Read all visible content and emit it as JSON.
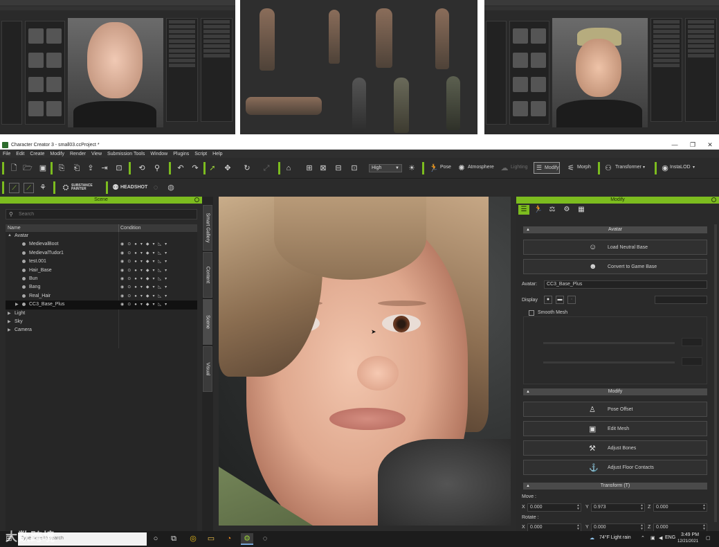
{
  "window": {
    "title": "Character Creator 3 - small03.ccProject *",
    "minimize": "—",
    "maximize": "❐",
    "close": "✕"
  },
  "menu": [
    "File",
    "Edit",
    "Create",
    "Modify",
    "Render",
    "View",
    "Submission Tools",
    "Window",
    "Plugins",
    "Script",
    "Help"
  ],
  "toolbar": {
    "quality": "High",
    "pose": "Pose",
    "atmosphere": "Atmosphere",
    "lighting": "Lighting",
    "modify": "Modify",
    "morph": "Morph",
    "transformer": "Transformer",
    "instalod": "InstaLOD",
    "substance": "SUBSTANCE PAINTER",
    "headshot": "HEADSHOT"
  },
  "scene": {
    "title": "Scene",
    "search_placeholder": "Search",
    "col_name": "Name",
    "col_condition": "Condition",
    "items": [
      {
        "label": "Avatar",
        "level": 0,
        "twist": "▲"
      },
      {
        "label": "MedievalBoot",
        "level": 2,
        "twist": ""
      },
      {
        "label": "MedievalTudor1",
        "level": 2,
        "twist": ""
      },
      {
        "label": "test.001",
        "level": 2,
        "twist": ""
      },
      {
        "label": "Hair_Base",
        "level": 2,
        "twist": ""
      },
      {
        "label": "Bun",
        "level": 2,
        "twist": ""
      },
      {
        "label": "Bang",
        "level": 2,
        "twist": ""
      },
      {
        "label": "Real_Hair",
        "level": 2,
        "twist": ""
      },
      {
        "label": "CC3_Base_Plus",
        "level": 1,
        "twist": "▶"
      },
      {
        "label": "Light",
        "level": 0,
        "twist": "▶"
      },
      {
        "label": "Sky",
        "level": 0,
        "twist": "▶"
      },
      {
        "label": "Camera",
        "level": 0,
        "twist": "▶"
      }
    ],
    "selected_item": "CC3_Base_Plus"
  },
  "side_tabs": [
    "Smart Gallery",
    "Content",
    "Scene",
    "Visual"
  ],
  "modify": {
    "title": "Modify",
    "avatar_section": "Avatar",
    "load_neutral": "Load Neutral Base",
    "convert_game": "Convert to Game Base",
    "avatar_label": "Avatar:",
    "avatar_value": "CC3_Base_Plus",
    "display_label": "Display",
    "smooth_mesh": "Smooth Mesh",
    "modify_section": "Modify",
    "pose_offset": "Pose Offset",
    "edit_mesh": "Edit Mesh",
    "adjust_bones": "Adjust Bones",
    "adjust_floor": "Adjust Floor Contacts",
    "transform_section": "Transform  (T)",
    "move_label": "Move :",
    "rotate_label": "Rotate :",
    "move": {
      "x": "0.000",
      "y": "0.973",
      "z": "0.000"
    },
    "rotate": {
      "x": "0.000",
      "y": "0.000",
      "z": "0.000"
    }
  },
  "taskbar": {
    "search_placeholder": "Type here to search",
    "weather": "74°F  Light rain",
    "lang": "ENG",
    "time": "3:49 PM",
    "date": "12/21/2021"
  },
  "watermark": "大数跨境",
  "colors": {
    "accent": "#7cbc1f",
    "panel": "#2a2a2a",
    "selected_row": "#111111"
  }
}
